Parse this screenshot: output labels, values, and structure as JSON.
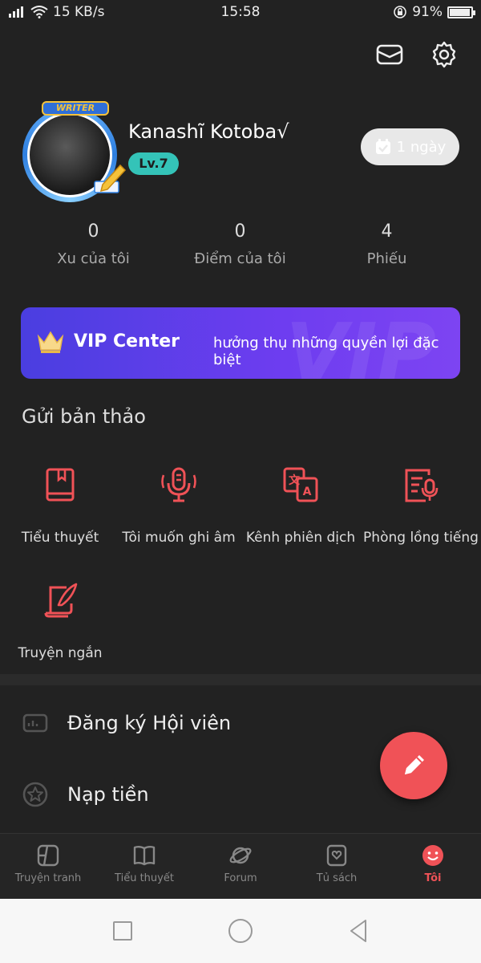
{
  "status_bar": {
    "speed": "15 KB/s",
    "time": "15:58",
    "battery": "91%",
    "battery_level": 0.91
  },
  "header_icons": [
    "mail-icon",
    "settings-icon"
  ],
  "profile": {
    "badge": "WRITER",
    "name": "Kanashĩ Kotoba√",
    "level": "Lv.7",
    "checkin": "1 ngày"
  },
  "stats": [
    {
      "value": "0",
      "label": "Xu của tôi"
    },
    {
      "value": "0",
      "label": "Điểm của tôi"
    },
    {
      "value": "4",
      "label": "Phiếu"
    }
  ],
  "vip": {
    "watermark": "VIP",
    "title": "VIP Center",
    "subtitle": "hưởng thụ những quyền lợi đặc biệt"
  },
  "submit_section": {
    "title": "Gửi bản thảo",
    "items": [
      {
        "label": "Tiểu thuyết",
        "icon": "book-icon"
      },
      {
        "label": "Tôi muốn ghi âm",
        "icon": "microphone-icon"
      },
      {
        "label": "Kênh phiên dịch",
        "icon": "translate-icon"
      },
      {
        "label": "Phòng lồng tiếng",
        "icon": "dubbing-icon"
      },
      {
        "label": "Truyện ngắn",
        "icon": "quill-icon"
      }
    ]
  },
  "menu": [
    {
      "label": "Đăng ký Hội viên",
      "icon": "membership-card-icon"
    },
    {
      "label": "Nạp tiền",
      "icon": "coin-star-icon"
    }
  ],
  "tabs": [
    {
      "label": "Truyện tranh",
      "icon": "comic-icon"
    },
    {
      "label": "Tiểu thuyết",
      "icon": "open-book-icon"
    },
    {
      "label": "Forum",
      "icon": "planet-icon"
    },
    {
      "label": "Tủ sách",
      "icon": "bookshelf-icon"
    },
    {
      "label": "Tôi",
      "icon": "smile-face-icon",
      "active": true
    }
  ],
  "colors": {
    "accent": "#f05257",
    "vip_gradient_start": "#4a3ee0",
    "vip_gradient_end": "#7d44f2",
    "level_badge": "#34c3b8"
  }
}
